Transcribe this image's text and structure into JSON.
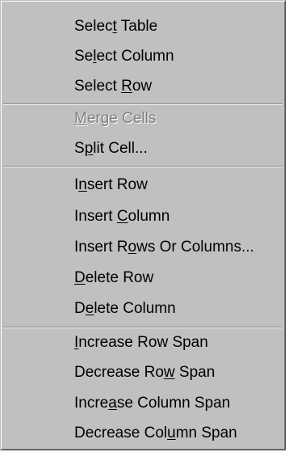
{
  "menu": {
    "groups": [
      {
        "items": [
          {
            "pre": "Selec",
            "mn": "t",
            "post": " Table",
            "enabled": true
          },
          {
            "pre": "Se",
            "mn": "l",
            "post": "ect Column",
            "enabled": true
          },
          {
            "pre": "Select ",
            "mn": "R",
            "post": "ow",
            "enabled": true
          }
        ]
      },
      {
        "items": [
          {
            "pre": "",
            "mn": "M",
            "post": "erge Cells",
            "enabled": false
          },
          {
            "pre": "S",
            "mn": "p",
            "post": "lit Cell...",
            "enabled": true
          }
        ]
      },
      {
        "items": [
          {
            "pre": "I",
            "mn": "n",
            "post": "sert Row",
            "enabled": true
          },
          {
            "pre": "Insert ",
            "mn": "C",
            "post": "olumn",
            "enabled": true
          },
          {
            "pre": "Insert R",
            "mn": "o",
            "post": "ws Or Columns...",
            "enabled": true
          },
          {
            "pre": "",
            "mn": "D",
            "post": "elete Row",
            "enabled": true
          },
          {
            "pre": "D",
            "mn": "e",
            "post": "lete Column",
            "enabled": true
          }
        ]
      },
      {
        "items": [
          {
            "pre": "",
            "mn": "I",
            "post": "ncrease Row Span",
            "enabled": true
          },
          {
            "pre": "Decrease Ro",
            "mn": "w",
            "post": " Span",
            "enabled": true
          },
          {
            "pre": "Incre",
            "mn": "a",
            "post": "se Column Span",
            "enabled": true
          },
          {
            "pre": "Decrease Col",
            "mn": "u",
            "post": "mn Span",
            "enabled": true
          }
        ]
      }
    ]
  }
}
